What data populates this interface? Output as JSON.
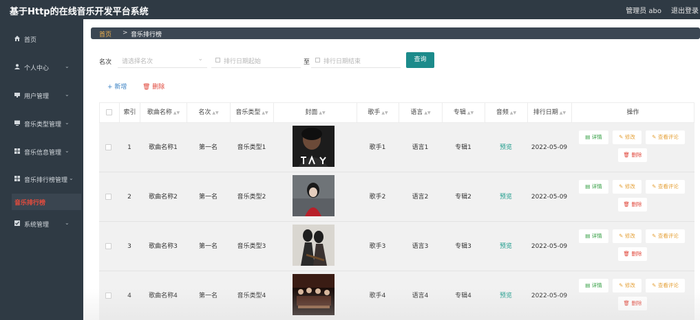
{
  "header": {
    "title": "基于Http的在线音乐开发平台系统",
    "admin_label": "管理员 abo",
    "logout_label": "退出登录"
  },
  "sidebar": {
    "items": [
      {
        "label": "首页",
        "icon": "home-icon",
        "has_children": false
      },
      {
        "label": "个人中心",
        "icon": "user-icon",
        "has_children": true
      },
      {
        "label": "用户管理",
        "icon": "card-icon",
        "has_children": true
      },
      {
        "label": "音乐类型管理",
        "icon": "monitor-icon",
        "has_children": true
      },
      {
        "label": "音乐信息管理",
        "icon": "grid-icon",
        "has_children": true
      },
      {
        "label": "音乐排行榜管理",
        "icon": "grid-icon",
        "has_children": true
      },
      {
        "label": "系统管理",
        "icon": "checkbox-icon",
        "has_children": true
      }
    ],
    "active_sub": "音乐排行榜"
  },
  "breadcrumb": {
    "home": "首页",
    "separator": ">",
    "current": "音乐排行榜"
  },
  "filters": {
    "rank_label": "名次",
    "rank_placeholder": "请选择名次",
    "date_start_placeholder": "排行日期起始",
    "to_label": "至",
    "date_end_placeholder": "排行日期结束",
    "query_button": "查询"
  },
  "actions": {
    "add": "+ 新增",
    "delete": "删除"
  },
  "table": {
    "columns": [
      "索引",
      "歌曲名称",
      "名次",
      "音乐类型",
      "封面",
      "歌手",
      "语言",
      "专辑",
      "音频",
      "排行日期",
      "操作"
    ],
    "rows": [
      {
        "index": "1",
        "song": "歌曲名称1",
        "rank": "第一名",
        "type": "音乐类型1",
        "singer": "歌手1",
        "language": "语言1",
        "album": "专辑1",
        "audio": "预览",
        "date": "2022-05-09"
      },
      {
        "index": "2",
        "song": "歌曲名称2",
        "rank": "第一名",
        "type": "音乐类型2",
        "singer": "歌手2",
        "language": "语言2",
        "album": "专辑2",
        "audio": "预览",
        "date": "2022-05-09"
      },
      {
        "index": "3",
        "song": "歌曲名称3",
        "rank": "第一名",
        "type": "音乐类型3",
        "singer": "歌手3",
        "language": "语言3",
        "album": "专辑3",
        "audio": "预览",
        "date": "2022-05-09"
      },
      {
        "index": "4",
        "song": "歌曲名称4",
        "rank": "第一名",
        "type": "音乐类型4",
        "singer": "歌手4",
        "language": "语言4",
        "album": "专辑4",
        "audio": "预览",
        "date": "2022-05-09"
      }
    ],
    "row_ops": {
      "detail": "详情",
      "edit": "修改",
      "comment": "查看评论",
      "delete": "删除"
    }
  },
  "colors": {
    "sidebar_bg": "#2f3a44",
    "accent_teal": "#1c8b8b",
    "danger": "#e0463a",
    "warning": "#e5a23a",
    "link_blue": "#3b82c4",
    "breadcrumb_home": "#f0b24e"
  }
}
